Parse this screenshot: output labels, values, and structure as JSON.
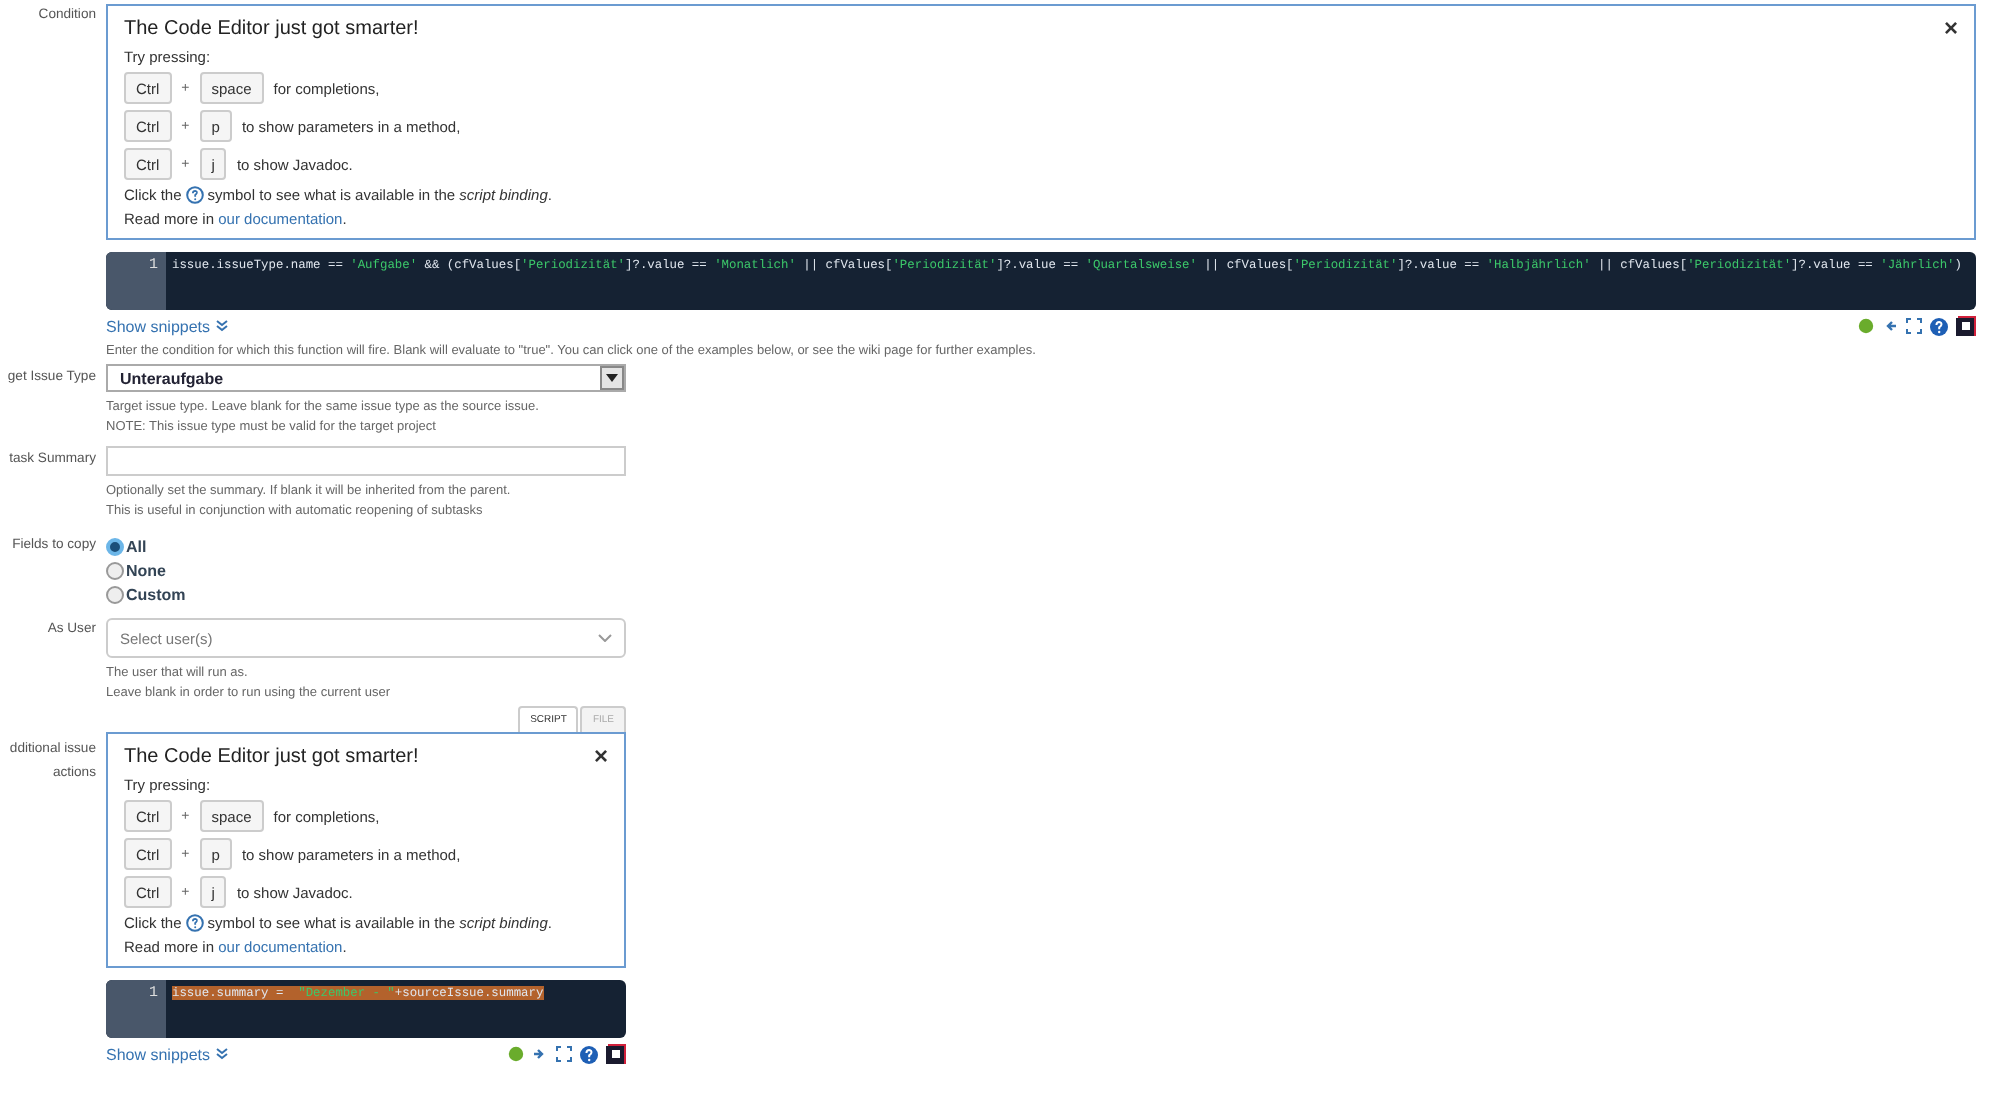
{
  "condition": {
    "label": "Condition",
    "hint": {
      "title": "The Code Editor just got smarter!",
      "intro": "Try pressing:",
      "close": "×",
      "shortcuts": [
        {
          "keys": [
            "Ctrl",
            "space"
          ],
          "plus": "+",
          "text": "for completions,"
        },
        {
          "keys": [
            "Ctrl",
            "p"
          ],
          "plus": "+",
          "text": "to show parameters in a method,"
        },
        {
          "keys": [
            "Ctrl",
            "j"
          ],
          "plus": "+",
          "text": "to show Javadoc."
        }
      ],
      "click_before": "Click the",
      "click_after": "symbol to see what is available in the *script binding*.",
      "read_more": "Read more in ",
      "doc_link": "our documentation",
      "read_more_end": "."
    },
    "editor": {
      "arrow_left": true,
      "lines": [
        {
          "number": "1",
          "highlighted": false,
          "tokens": [
            {
              "kind": "plain",
              "text": "issue.issueType.name == "
            },
            {
              "kind": "string",
              "text": "'Aufgabe'"
            },
            {
              "kind": "plain",
              "text": " && (cfValues["
            },
            {
              "kind": "string",
              "text": "'Periodizität'"
            },
            {
              "kind": "plain",
              "text": "]?.value == "
            },
            {
              "kind": "string",
              "text": "'Monatlich'"
            },
            {
              "kind": "plain",
              "text": " || cfValues["
            },
            {
              "kind": "string",
              "text": "'Periodizität'"
            },
            {
              "kind": "plain",
              "text": "]?.value == "
            },
            {
              "kind": "string",
              "text": "'Quartalsweise'"
            },
            {
              "kind": "plain",
              "text": " || cfValues["
            },
            {
              "kind": "string",
              "text": "'Periodizität'"
            },
            {
              "kind": "plain",
              "text": "]?.value == "
            },
            {
              "kind": "string",
              "text": "'Halbjährlich'"
            },
            {
              "kind": "plain",
              "text": " || cfValues["
            },
            {
              "kind": "string",
              "text": "'Periodizität'"
            },
            {
              "kind": "plain",
              "text": "]?.value == "
            },
            {
              "kind": "string",
              "text": "'Jährlich'"
            },
            {
              "kind": "plain",
              "text": ")"
            }
          ]
        }
      ]
    },
    "snippets": "Show snippets",
    "help": [
      "Enter the condition for which this function will fire. Blank will evaluate to \"true\". You can click one of the examples below, or see the wiki page for further examples."
    ]
  },
  "target_issue_type": {
    "label": "get Issue Type",
    "value": "Unteraufgabe",
    "help": [
      "Target issue type. Leave blank for the same issue type as the source issue.",
      "NOTE: This issue type must be valid for the target project"
    ]
  },
  "subtask_summary": {
    "label": "task Summary",
    "help": [
      "Optionally set the summary. If blank it will be inherited from the parent.",
      "This is useful in conjunction with automatic reopening of subtasks"
    ]
  },
  "fields_to_copy": {
    "label": "Fields to copy",
    "options": [
      {
        "label": "All",
        "selected": true
      },
      {
        "label": "None",
        "selected": false
      },
      {
        "label": "Custom",
        "selected": false
      }
    ]
  },
  "as_user": {
    "label": "As User",
    "placeholder": "Select user(s)",
    "help": [
      "The user that will run as.",
      "Leave blank in order to run using the current user"
    ]
  },
  "additional_actions": {
    "label": "dditional issue actions",
    "tabs": [
      {
        "label": "SCRIPT",
        "selected": true
      },
      {
        "label": "FILE",
        "selected": false
      }
    ],
    "hint": {
      "title": "The Code Editor just got smarter!",
      "intro": "Try pressing:",
      "close": "×",
      "shortcuts": [
        {
          "keys": [
            "Ctrl",
            "space"
          ],
          "plus": "+",
          "text": "for completions,"
        },
        {
          "keys": [
            "Ctrl",
            "p"
          ],
          "plus": "+",
          "text": "to show parameters in a method,"
        },
        {
          "keys": [
            "Ctrl",
            "j"
          ],
          "plus": "+",
          "text": "to show Javadoc."
        }
      ],
      "click_before": "Click the",
      "click_after": "symbol to see what is available in the *script binding*.",
      "read_more": "Read more in ",
      "doc_link": "our documentation",
      "read_more_end": "."
    },
    "editor": {
      "arrow_left": false,
      "lines": [
        {
          "number": "1",
          "highlighted": true,
          "tokens": [
            {
              "kind": "plain",
              "text": "issue.summary =  "
            },
            {
              "kind": "string",
              "text": "\"Dezember - \""
            },
            {
              "kind": "plain",
              "text": "+sourceIssue.summary"
            }
          ]
        }
      ]
    },
    "snippets": "Show snippets"
  }
}
